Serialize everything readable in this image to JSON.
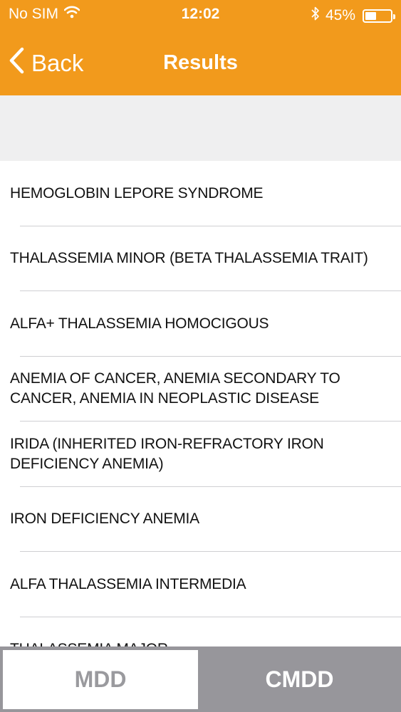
{
  "status_bar": {
    "carrier": "No SIM",
    "time": "12:02",
    "battery_percent": "45%",
    "battery_level": 0.45,
    "icons": [
      "wifi-icon",
      "bluetooth-icon",
      "battery-icon"
    ]
  },
  "nav": {
    "back_label": "Back",
    "title": "Results"
  },
  "results": [
    "HEMOGLOBIN LEPORE SYNDROME",
    "THALASSEMIA MINOR  (BETA THALASSEMIA TRAIT)",
    "ALFA+ THALASSEMIA HOMOCIGOUS",
    "ANEMIA OF CANCER, ANEMIA SECONDARY TO CANCER, ANEMIA IN NEOPLASTIC DISEASE",
    "IRIDA (INHERITED IRON-REFRACTORY IRON DEFICIENCY ANEMIA)",
    "IRON DEFICIENCY ANEMIA",
    "ALFA THALASSEMIA INTERMEDIA",
    "THALASSEMIA MAJOR"
  ],
  "tabs": {
    "mdd_label": "MDD",
    "cmdd_label": "CMDD"
  },
  "colors": {
    "accent": "#f29a1c",
    "tab_bar": "#97969b",
    "search_band": "#efeff0"
  }
}
